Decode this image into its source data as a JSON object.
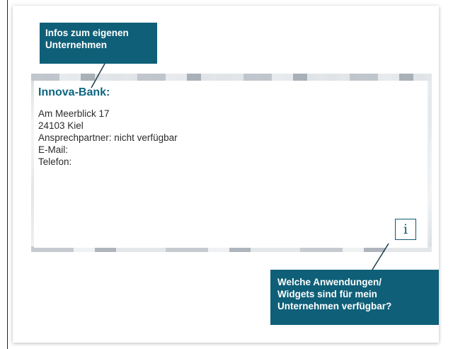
{
  "card": {
    "bank_name": "Innova-Bank:",
    "address_lines": [
      "Am Meerblick 17",
      "24103 Kiel",
      "Ansprechpartner: nicht verfügbar",
      "E-Mail:",
      "Telefon:"
    ],
    "info_button_glyph": "i",
    "info_button_icon": "info-icon"
  },
  "callouts": {
    "company_info": {
      "lines": [
        "Infos zum eigenen",
        "Unternehmen"
      ]
    },
    "widgets": {
      "lines": [
        "Welche Anwendungen/",
        "Widgets sind für mein",
        "Unternehmen verfügbar?"
      ]
    }
  },
  "colors": {
    "accent": "#0f5f78",
    "bank_name": "#0e6580",
    "text": "#2b2b2b"
  }
}
